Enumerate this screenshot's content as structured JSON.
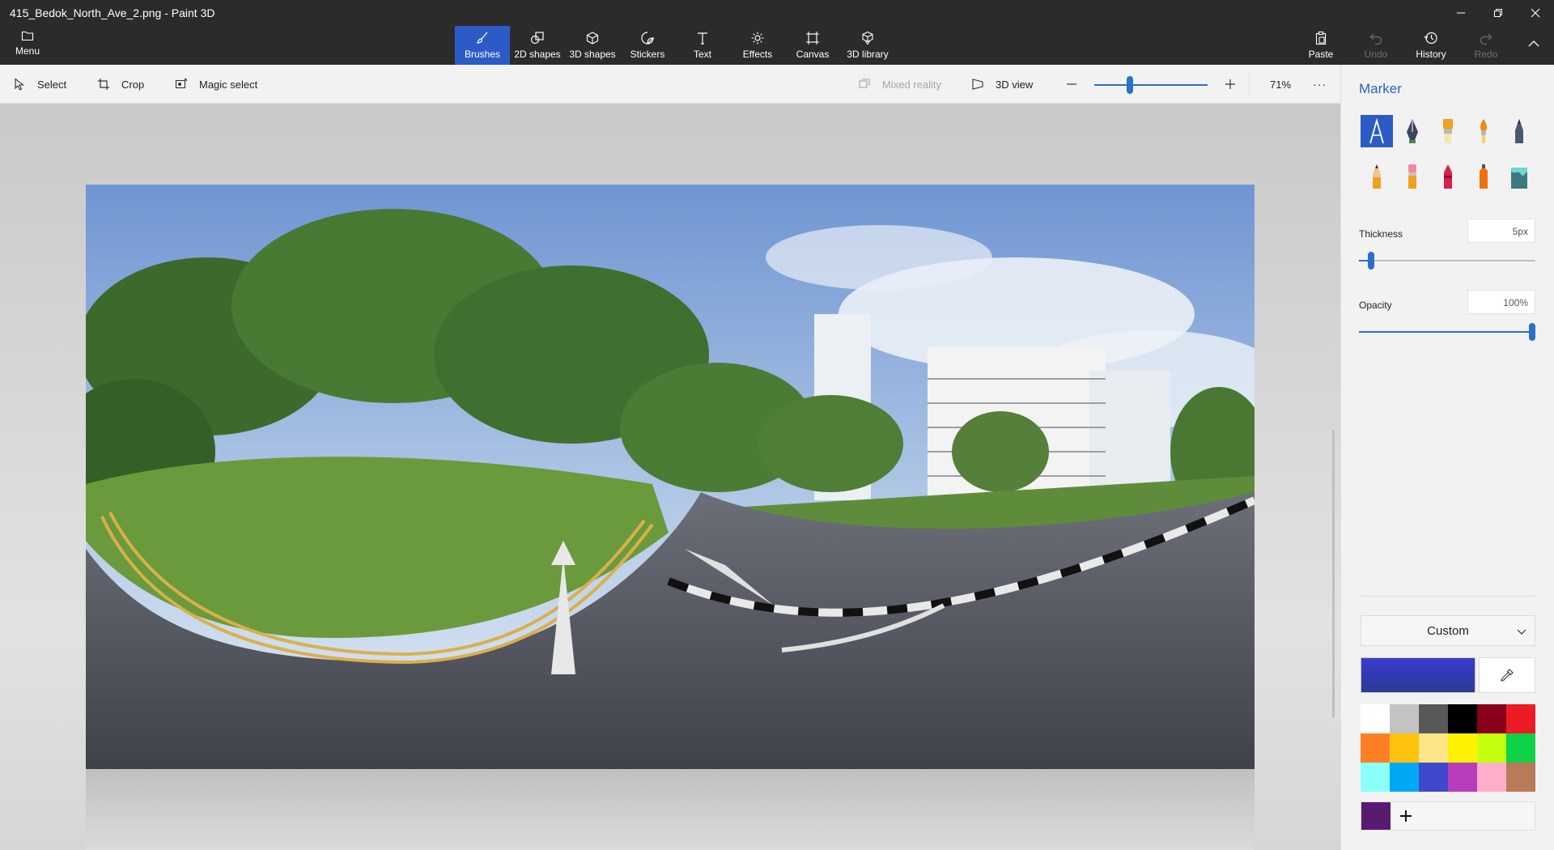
{
  "window": {
    "title": "415_Bedok_North_Ave_2.png - Paint 3D"
  },
  "ribbon": {
    "menu_label": "Menu",
    "tools": [
      {
        "label": "Brushes",
        "icon": "brush-icon",
        "active": true
      },
      {
        "label": "2D shapes",
        "icon": "2d-shapes-icon"
      },
      {
        "label": "3D shapes",
        "icon": "3d-shapes-icon"
      },
      {
        "label": "Stickers",
        "icon": "stickers-icon"
      },
      {
        "label": "Text",
        "icon": "text-icon"
      },
      {
        "label": "Effects",
        "icon": "effects-icon"
      },
      {
        "label": "Canvas",
        "icon": "canvas-icon"
      },
      {
        "label": "3D library",
        "icon": "3d-library-icon"
      }
    ],
    "paste_label": "Paste",
    "undo_label": "Undo",
    "history_label": "History",
    "redo_label": "Redo"
  },
  "toolbar": {
    "select_label": "Select",
    "crop_label": "Crop",
    "magic_select_label": "Magic select",
    "mixed_reality_label": "Mixed reality",
    "view_3d_label": "3D view",
    "zoom_percent": "71%",
    "zoom_fraction": 0.3,
    "more_label": "···"
  },
  "panel": {
    "title": "Marker",
    "brushes": [
      {
        "name": "marker",
        "active": true
      },
      {
        "name": "calligraphy-pen"
      },
      {
        "name": "oil-brush"
      },
      {
        "name": "watercolor"
      },
      {
        "name": "pixel-pen"
      },
      {
        "name": "pencil"
      },
      {
        "name": "eraser"
      },
      {
        "name": "crayon"
      },
      {
        "name": "spray-can"
      },
      {
        "name": "fill"
      }
    ],
    "thickness_label": "Thickness",
    "thickness_value": "5px",
    "thickness_fraction": 0.05,
    "opacity_label": "Opacity",
    "opacity_value": "100%",
    "opacity_fraction": 1.0,
    "color_mode": "Custom",
    "current_color": "#3a3ad0",
    "palette": [
      "#ffffff",
      "#c3c3c3",
      "#585858",
      "#000000",
      "#88001b",
      "#ec1c24",
      "#ff7f27",
      "#ffc20e",
      "#fde68a",
      "#fff200",
      "#c4ff0e",
      "#0ed145",
      "#8cfffb",
      "#00a8f3",
      "#3f48cc",
      "#b83dba",
      "#ffaec9",
      "#b97a57"
    ],
    "custom_color": "#5b1a72"
  }
}
